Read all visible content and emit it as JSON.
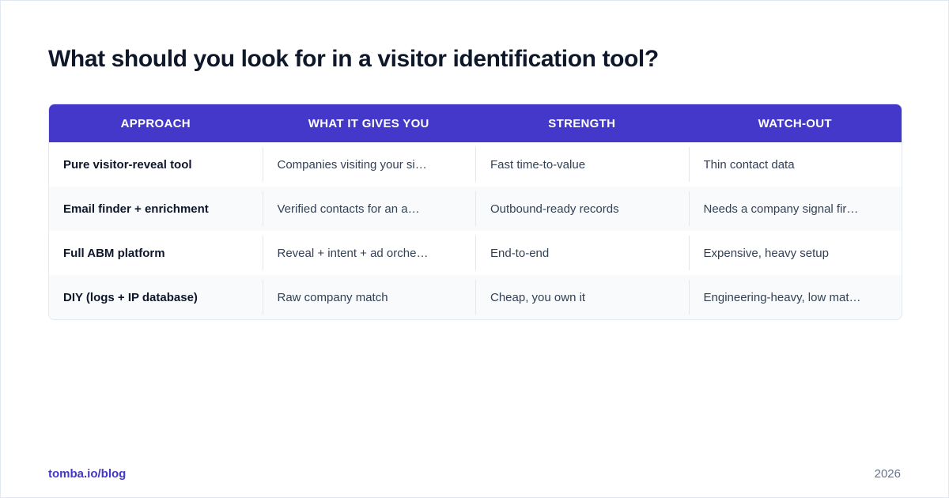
{
  "title": "What should you look for in a visitor identification tool?",
  "table": {
    "headers": [
      "APPROACH",
      "WHAT IT GIVES YOU",
      "STRENGTH",
      "WATCH-OUT"
    ],
    "rows": [
      [
        "Pure visitor-reveal tool",
        "Companies visiting your si…",
        "Fast time-to-value",
        "Thin contact data"
      ],
      [
        "Email finder + enrichment",
        "Verified contacts for an a…",
        "Outbound-ready records",
        "Needs a company signal fir…"
      ],
      [
        "Full ABM platform",
        "Reveal + intent + ad orche…",
        "End-to-end",
        "Expensive, heavy setup"
      ],
      [
        "DIY (logs + IP database)",
        "Raw company match",
        "Cheap, you own it",
        "Engineering-heavy, low mat…"
      ]
    ]
  },
  "footer": {
    "source": "tomba.io/blog",
    "year": "2026"
  },
  "colors": {
    "header_bg": "#4338ca",
    "accent": "#4338ca",
    "alt_row_bg": "#f8fafc"
  }
}
